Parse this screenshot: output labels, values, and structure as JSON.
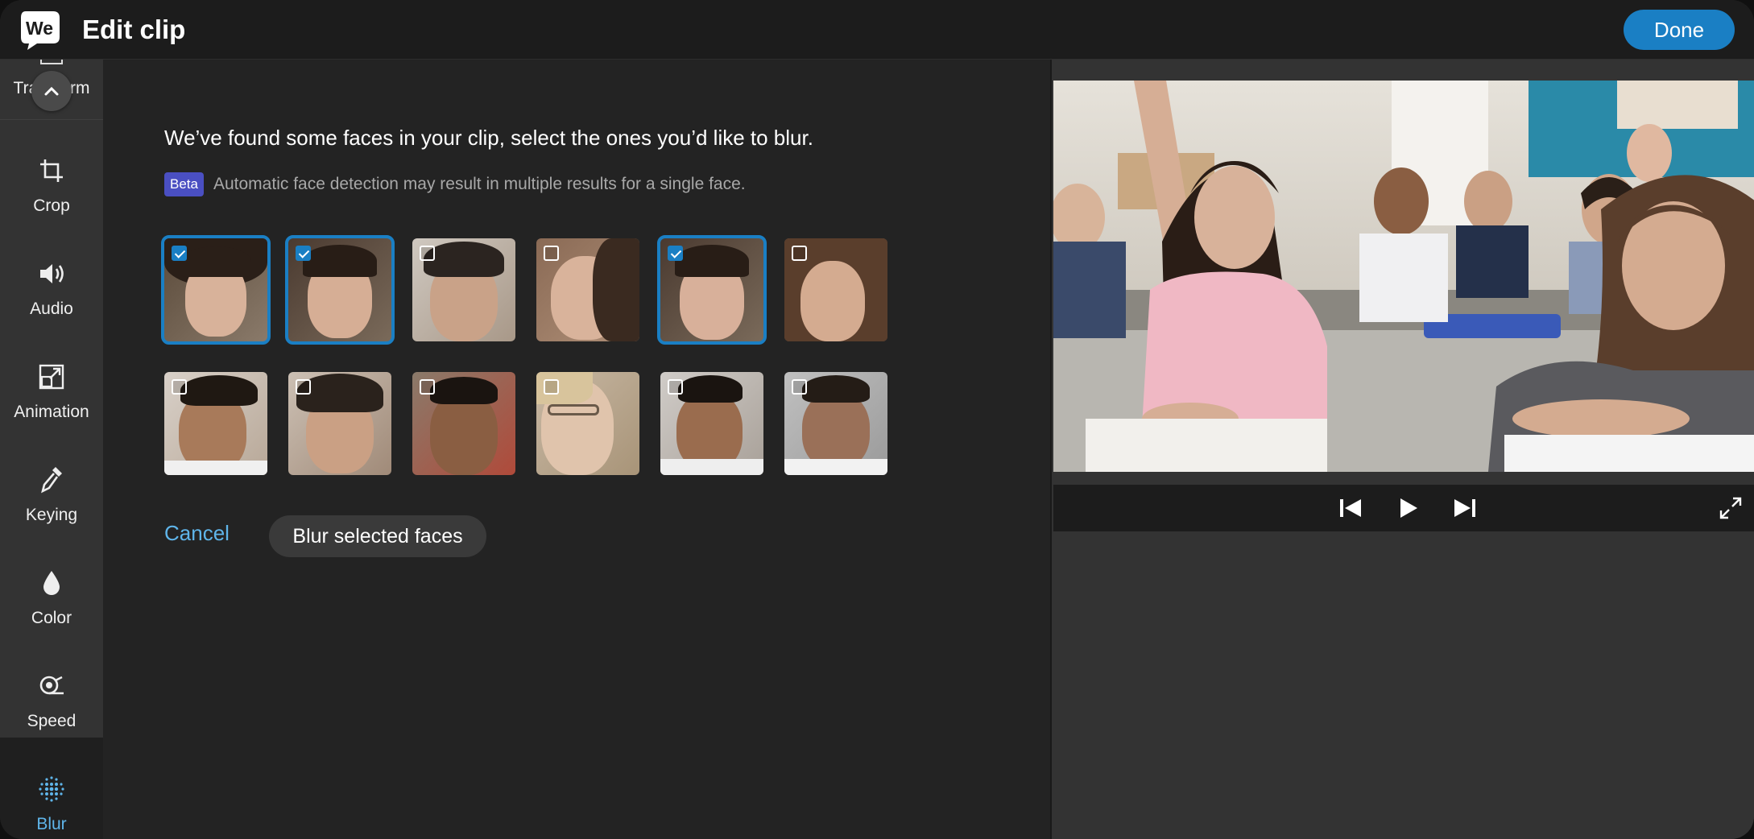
{
  "header": {
    "title": "Edit clip",
    "done_label": "Done"
  },
  "sidebar": {
    "transform_label": "Transform",
    "items": [
      {
        "label": "Crop",
        "icon": "crop-icon"
      },
      {
        "label": "Audio",
        "icon": "audio-icon"
      },
      {
        "label": "Animation",
        "icon": "animation-icon"
      },
      {
        "label": "Keying",
        "icon": "keying-icon"
      },
      {
        "label": "Color",
        "icon": "color-icon"
      },
      {
        "label": "Speed",
        "icon": "speed-icon"
      },
      {
        "label": "Blur",
        "icon": "blur-icon",
        "active": true
      }
    ]
  },
  "main": {
    "heading": "We’ve found some faces in your clip, select the ones you’d like to blur.",
    "beta_badge": "Beta",
    "beta_text": "Automatic face detection may result in multiple results for a single face.",
    "faces": [
      {
        "selected": true
      },
      {
        "selected": true
      },
      {
        "selected": false
      },
      {
        "selected": false
      },
      {
        "selected": true
      },
      {
        "selected": false
      },
      {
        "selected": false
      },
      {
        "selected": false
      },
      {
        "selected": false
      },
      {
        "selected": false
      },
      {
        "selected": false
      },
      {
        "selected": false
      }
    ],
    "cancel_label": "Cancel",
    "blur_button_label": "Blur selected faces"
  },
  "colors": {
    "accent": "#1a7fc4",
    "link": "#5fb5ea",
    "beta": "#4a4fc2"
  }
}
